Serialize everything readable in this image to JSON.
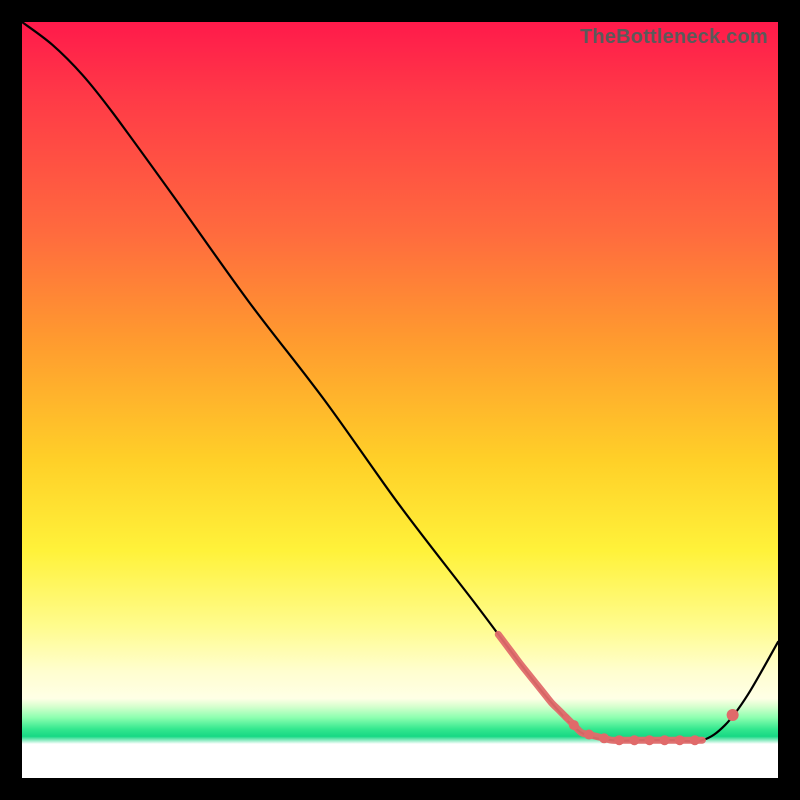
{
  "watermark": "TheBottleneck.com",
  "colors": {
    "curve": "#000000",
    "highlight": "#e06a6a",
    "gradient_top": "#ff1a4b",
    "gradient_mid": "#fff23a",
    "gradient_green": "#17d884"
  },
  "chart_data": {
    "type": "line",
    "title": "",
    "xlabel": "",
    "ylabel": "",
    "xlim": [
      0,
      100
    ],
    "ylim": [
      0,
      100
    ],
    "series": [
      {
        "name": "curve",
        "x": [
          0,
          4,
          8,
          12,
          20,
          30,
          40,
          50,
          60,
          66,
          70,
          74,
          78,
          82,
          86,
          90,
          93,
          96,
          100
        ],
        "y": [
          100,
          97,
          93,
          88,
          77,
          63,
          50,
          36,
          23,
          15,
          10,
          6,
          5,
          5,
          5,
          5,
          7,
          11,
          18
        ]
      }
    ],
    "highlights": {
      "descending_segment": {
        "x_start": 63,
        "x_end": 72
      },
      "valley_segment": {
        "x_start": 72,
        "x_end": 90
      },
      "ascending_point_x": 94,
      "valley_dot_xs": [
        73,
        75,
        77,
        79,
        81,
        83,
        85,
        87,
        89
      ]
    }
  }
}
